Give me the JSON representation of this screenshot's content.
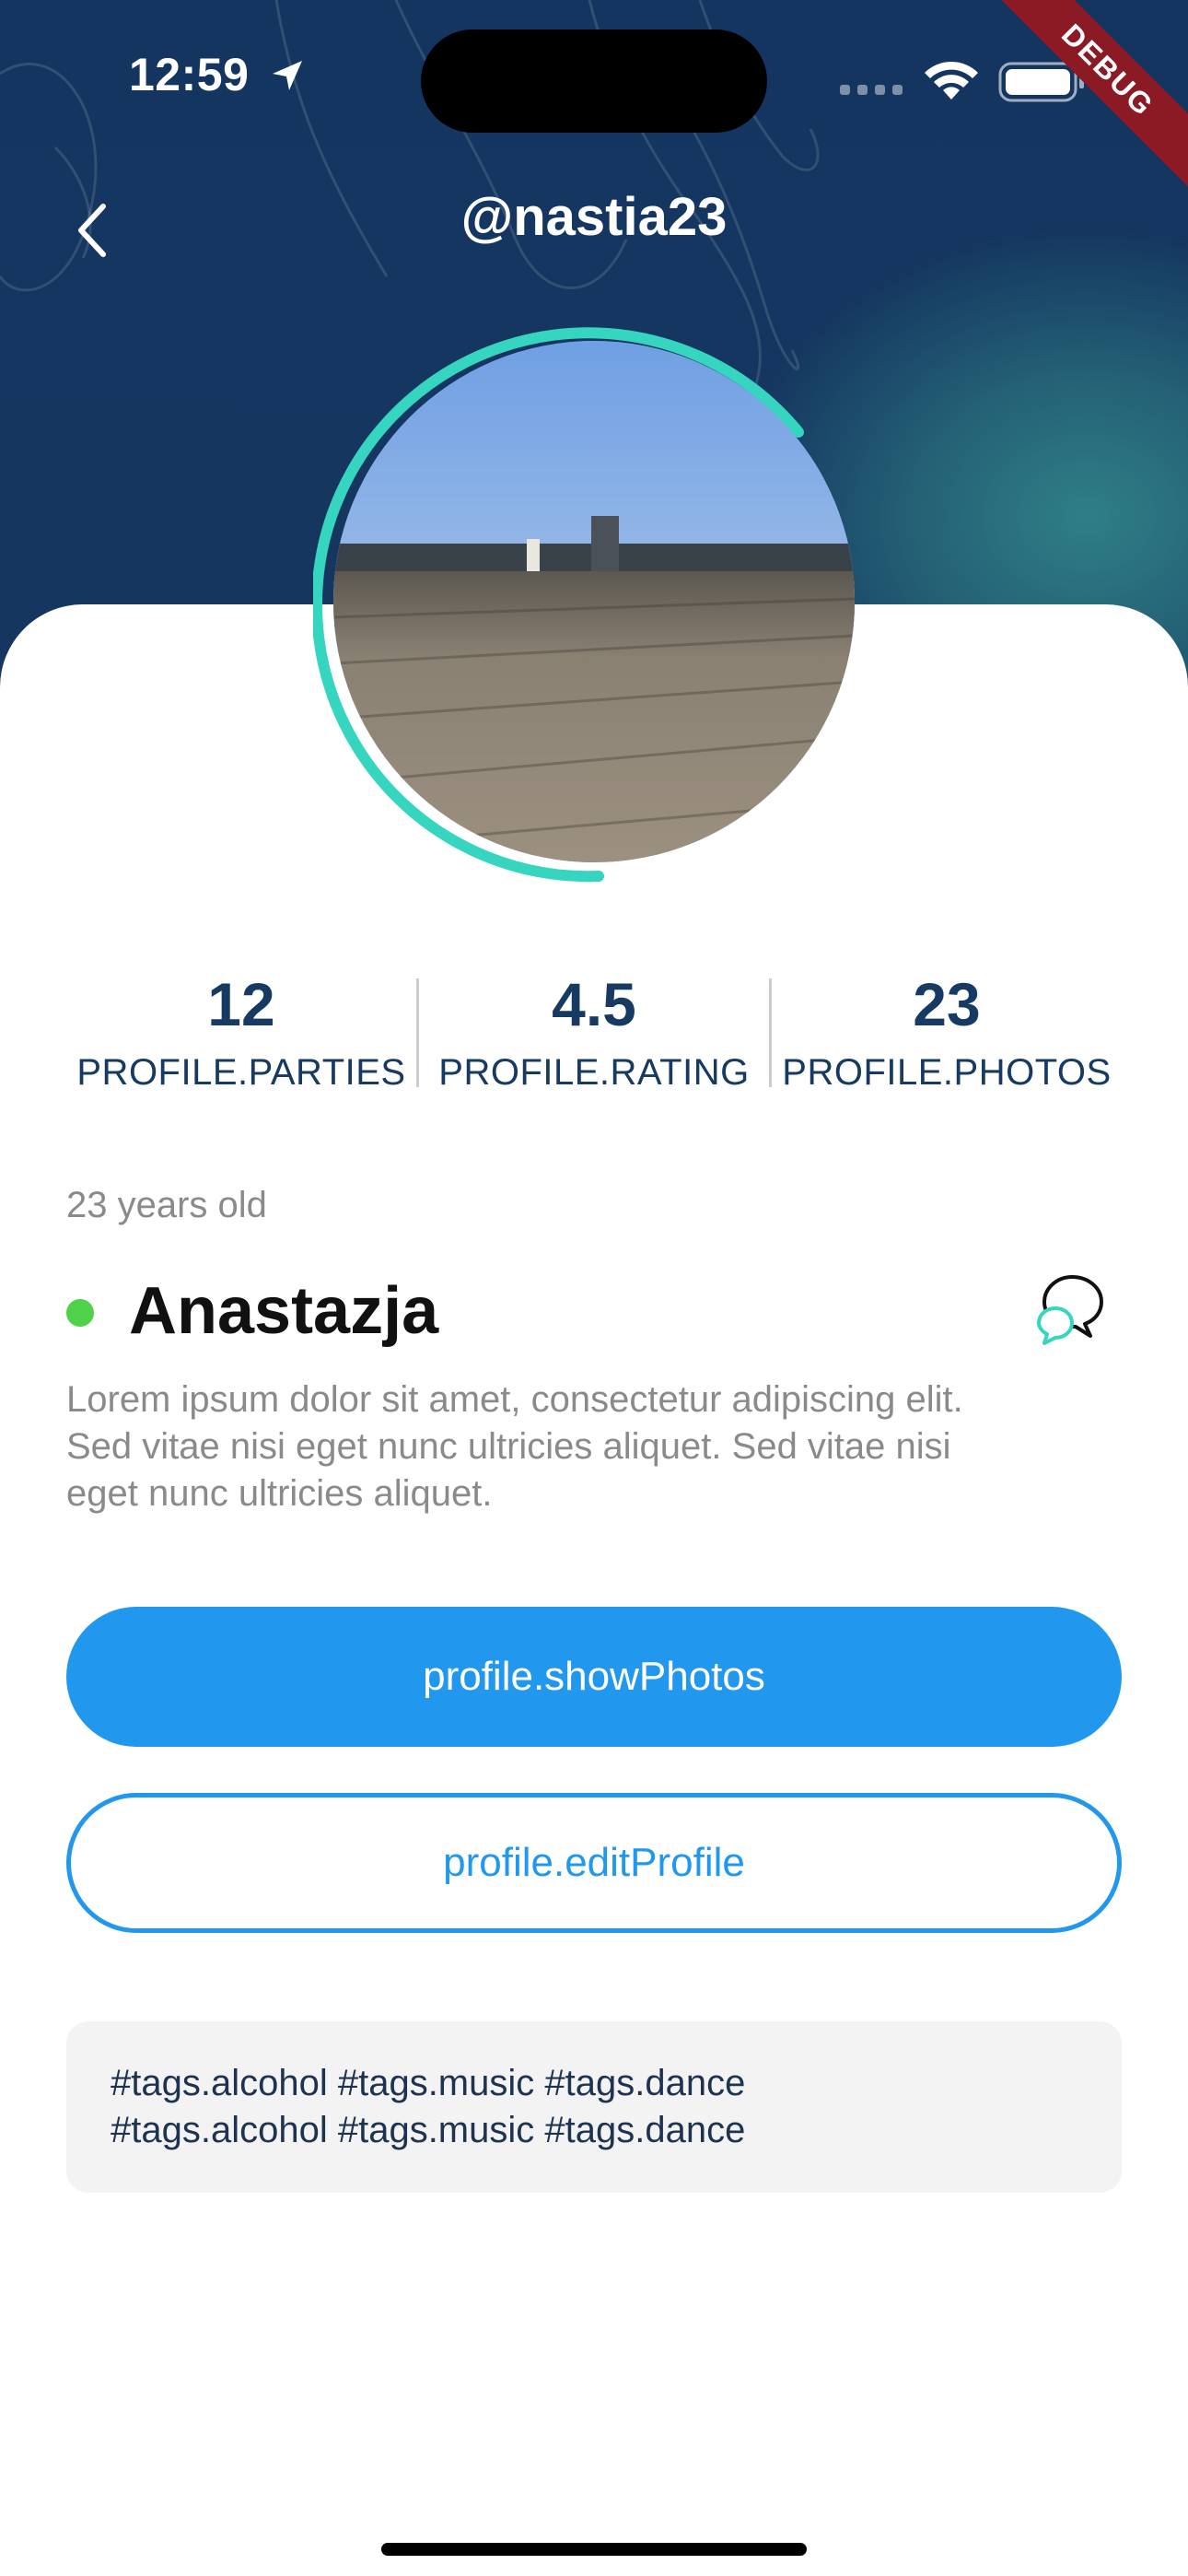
{
  "status_bar": {
    "time": "12:59"
  },
  "debug_ribbon": "DEBUG",
  "nav": {
    "title": "@nastia23"
  },
  "stats": [
    {
      "value": "12",
      "label": "PROFILE.PARTIES"
    },
    {
      "value": "4.5",
      "label": "PROFILE.RATING"
    },
    {
      "value": "23",
      "label": "PROFILE.PHOTOS"
    }
  ],
  "profile": {
    "age": "23 years old",
    "name": "Anastazja",
    "bio": "Lorem ipsum dolor sit amet, consectetur adipiscing elit. Sed vitae nisi eget nunc ultricies aliquet. Sed vitae nisi eget nunc ultricies aliquet.",
    "online": true
  },
  "buttons": {
    "show_photos": "profile.showPhotos",
    "edit_profile": "profile.editProfile"
  },
  "tags": {
    "line1": "#tags.alcohol #tags.music #tags.dance",
    "line2": "#tags.alcohol #tags.music #tags.dance"
  },
  "colors": {
    "header": "#143560",
    "accent": "#2198ee",
    "ring": "#35d5c0",
    "online": "#4fd14a",
    "stat_text": "#163a62"
  },
  "icons": {
    "back": "chevron-left-icon",
    "chat": "chat-bubbles-icon",
    "location": "location-arrow-icon",
    "wifi": "wifi-icon",
    "battery": "battery-icon",
    "signal": "signal-icon"
  }
}
